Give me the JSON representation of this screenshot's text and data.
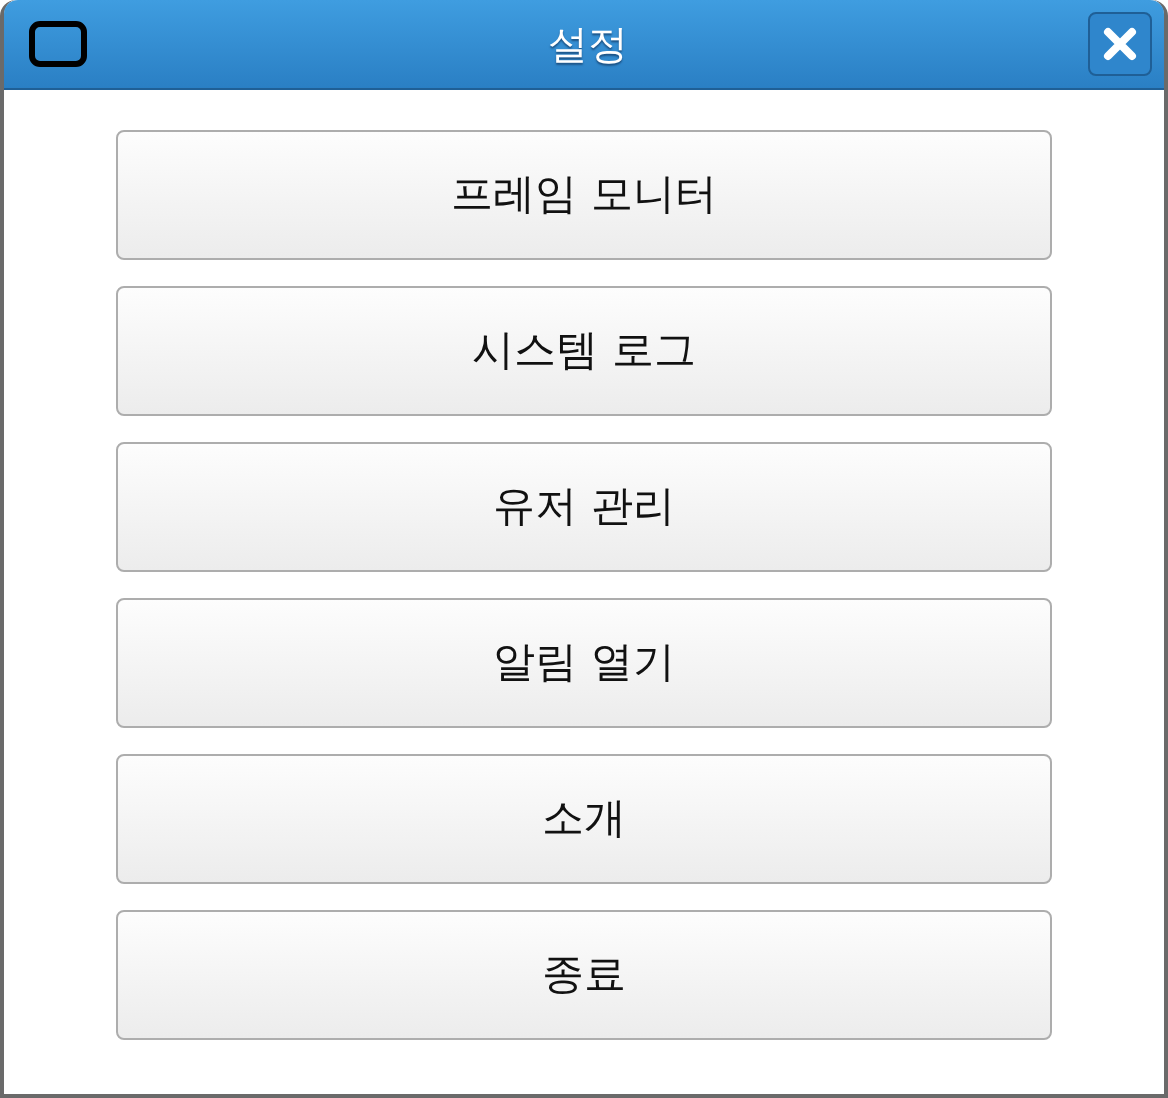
{
  "window": {
    "title": "설정"
  },
  "buttons": [
    {
      "label": "프레임 모니터"
    },
    {
      "label": "시스템 로그"
    },
    {
      "label": "유저 관리"
    },
    {
      "label": "알림 열기"
    },
    {
      "label": "소개"
    },
    {
      "label": "종료"
    }
  ]
}
